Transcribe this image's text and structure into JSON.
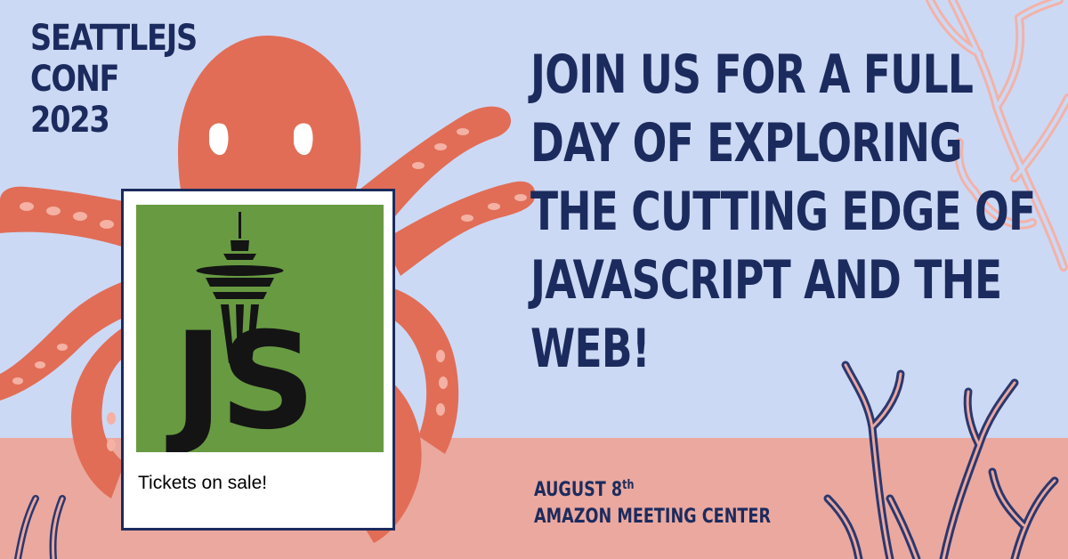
{
  "colors": {
    "sky": "#ccd9f4",
    "sand": "#eba89e",
    "octopus": "#e16d57",
    "suckers": "#f4b1a4",
    "navy": "#1c2b5e",
    "logo_green": "#689a42",
    "logo_black": "#141414",
    "coral_outline_light": "#f3b2a8",
    "coral_outline_dark": "#2a3870"
  },
  "event": {
    "title_lines": [
      "SEATTLEJS",
      "CONF",
      "2023"
    ]
  },
  "headline": {
    "lines": [
      "JOIN US FOR A FULL",
      "DAY OF EXPLORING",
      "THE CUTTING EDGE OF",
      "JAVASCRIPT AND THE",
      "WEB!"
    ]
  },
  "details": {
    "date_main": "AUGUST 8",
    "date_suffix": "th",
    "venue": "AMAZON MEETING CENTER"
  },
  "ticket_card": {
    "logo_letters": "JS",
    "caption": "Tickets on sale!"
  },
  "icons": {
    "mascot": "octopus-illustration",
    "logo": "space-needle-icon",
    "decoration": "coral-icon"
  }
}
